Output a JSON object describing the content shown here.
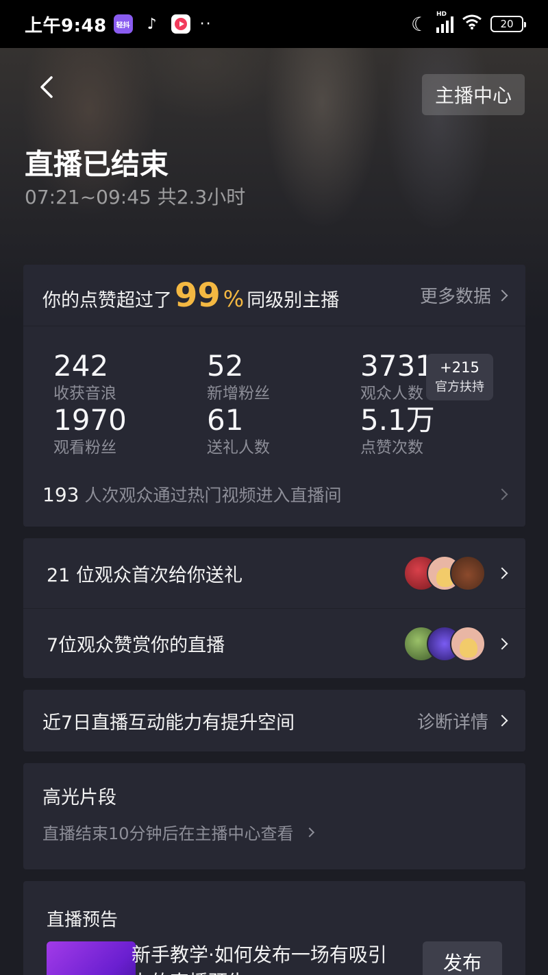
{
  "status_bar": {
    "time": "上午9:48",
    "app_qingdou": "轻抖",
    "app_tiktok": "♪",
    "dots": "··",
    "network": "HD",
    "battery": "20"
  },
  "header": {
    "anchor_center": "主播中心",
    "title": "直播已结束",
    "time_range": "07:21~09:45 共2.3小时"
  },
  "likes": {
    "prefix": "你的点赞超过了",
    "percent": "99",
    "percent_sign": "%",
    "suffix": "同级别主播",
    "more": "更多数据"
  },
  "stats": [
    {
      "value": "242",
      "label": "收获音浪"
    },
    {
      "value": "52",
      "label": "新增粉丝"
    },
    {
      "value": "3731",
      "label": "观众人数"
    },
    {
      "value": "1970",
      "label": "观看粉丝"
    },
    {
      "value": "61",
      "label": "送礼人数"
    },
    {
      "value": "5.1万",
      "label": "点赞次数"
    }
  ],
  "support": {
    "plus": "+215",
    "label": "官方扶持"
  },
  "hot_video": {
    "count": "193",
    "text": "人次观众通过热门视频进入直播间"
  },
  "gifts": [
    {
      "text": "21 位观众首次给你送礼"
    },
    {
      "text": "7位观众赞赏你的直播"
    }
  ],
  "ability": {
    "text": "近7日直播互动能力有提升空间",
    "link": "诊断详情"
  },
  "highlight": {
    "title": "高光片段",
    "sub": "直播结束10分钟后在主播中心查看"
  },
  "preview": {
    "title": "直播预告",
    "desc": "新手教学·如何发布一场有吸引力的直播预告",
    "button": "发布"
  }
}
